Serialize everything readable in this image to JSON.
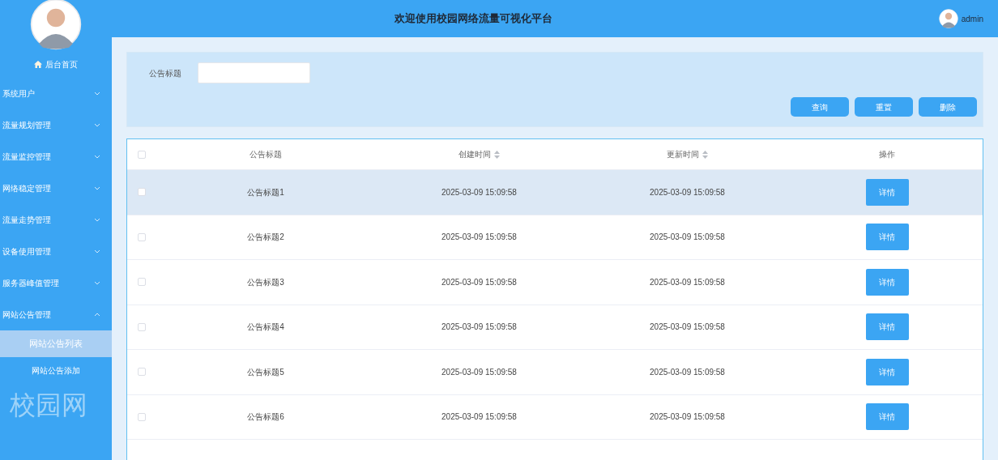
{
  "header": {
    "title": "欢迎使用校园网络流量可视化平台",
    "user": "admin"
  },
  "sidebar": {
    "home": "后台首页",
    "watermark": "校园网",
    "items": [
      {
        "label": "系统用户",
        "expanded": false
      },
      {
        "label": "流量规划管理",
        "expanded": false
      },
      {
        "label": "流量监控管理",
        "expanded": false
      },
      {
        "label": "网络稳定管理",
        "expanded": false
      },
      {
        "label": "流量走势管理",
        "expanded": false
      },
      {
        "label": "设备使用管理",
        "expanded": false
      },
      {
        "label": "服务器峰值管理",
        "expanded": false
      },
      {
        "label": "网站公告管理",
        "expanded": true,
        "children": [
          {
            "label": "网站公告列表",
            "selected": true
          },
          {
            "label": "网站公告添加",
            "selected": false
          }
        ]
      }
    ]
  },
  "search": {
    "label": "公告标题",
    "buttons": [
      "查询",
      "重置",
      "删除"
    ]
  },
  "table": {
    "columns": [
      {
        "label": "公告标题",
        "sortable": false
      },
      {
        "label": "创建时间",
        "sortable": true
      },
      {
        "label": "更新时间",
        "sortable": true
      },
      {
        "label": "操作",
        "sortable": false
      }
    ],
    "header_checked": false,
    "rows": [
      {
        "title": "公告标题1",
        "created": "2025-03-09 15:09:58",
        "updated": "2025-03-09 15:09:58",
        "action": "详情",
        "checked": false,
        "highlighted": true
      },
      {
        "title": "公告标题2",
        "created": "2025-03-09 15:09:58",
        "updated": "2025-03-09 15:09:58",
        "action": "详情",
        "checked": false,
        "highlighted": false
      },
      {
        "title": "公告标题3",
        "created": "2025-03-09 15:09:58",
        "updated": "2025-03-09 15:09:58",
        "action": "详情",
        "checked": false,
        "highlighted": false
      },
      {
        "title": "公告标题4",
        "created": "2025-03-09 15:09:58",
        "updated": "2025-03-09 15:09:58",
        "action": "详情",
        "checked": false,
        "highlighted": false
      },
      {
        "title": "公告标题5",
        "created": "2025-03-09 15:09:58",
        "updated": "2025-03-09 15:09:58",
        "action": "详情",
        "checked": false,
        "highlighted": false
      },
      {
        "title": "公告标题6",
        "created": "2025-03-09 15:09:58",
        "updated": "2025-03-09 15:09:58",
        "action": "详情",
        "checked": false,
        "highlighted": false
      }
    ]
  }
}
